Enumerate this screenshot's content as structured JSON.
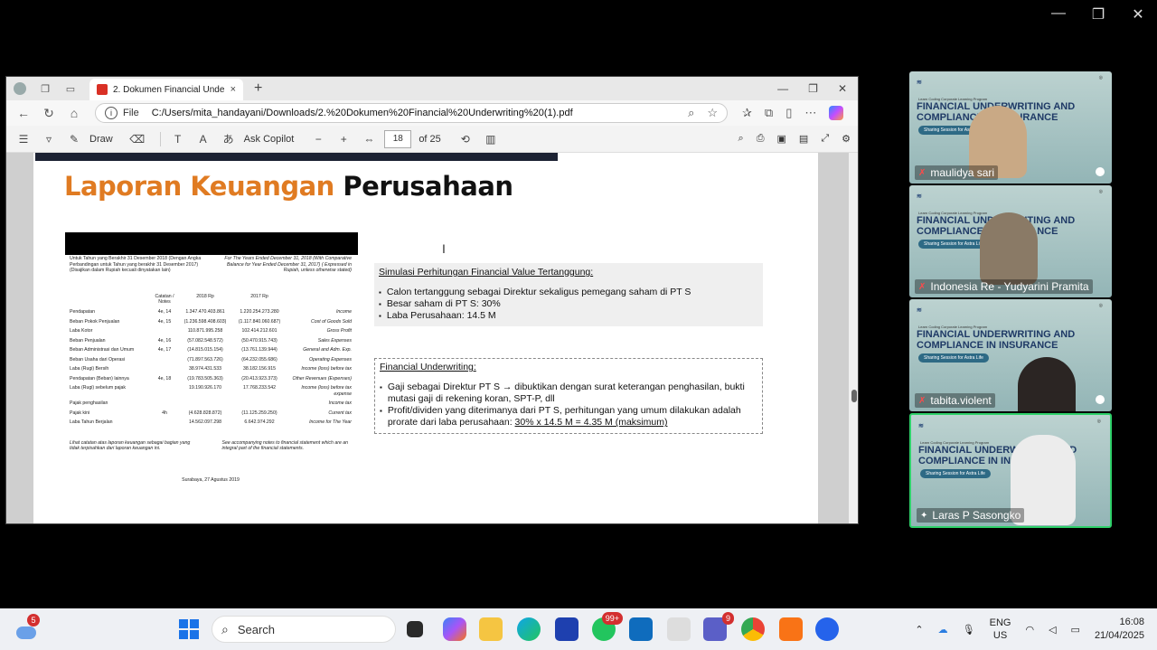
{
  "zoom_window": {
    "minimize": "—",
    "restore": "❐",
    "close": "✕"
  },
  "browser": {
    "tab_title": "2. Dokumen Financial Underwriting",
    "new_tab": "+",
    "tab_close": "×",
    "win_minimize": "—",
    "win_restore": "❐",
    "win_close": "✕",
    "url_scheme": "File",
    "url": "C:/Users/mita_handayani/Downloads/2.%20Dokumen%20Financial%20Underwriting%20(1).pdf"
  },
  "pdf_toolbar": {
    "draw_label": "Draw",
    "ask_copilot_label": "Ask Copilot",
    "zoom_out": "−",
    "zoom_in": "+",
    "page_current": "18",
    "page_total": "of 25"
  },
  "slide": {
    "title_part1": "Laporan Keuangan",
    "title_part2": "Perusahaan",
    "fin_header_left": "Untuk Tahun yang Berakhir 31 Desember 2018 (Dengan Angka Perbandingan untuk Tahun yang berakhir 31 Desember 2017) (Disajikan dalam Rupiah kecuali dinyatakan lain)",
    "fin_header_right": "For The Years Ended December 31, 2018 (With Comparative Balance for Year Ended December 31, 2017) ( Expressed in Rupiah, unless otherwise stated)",
    "col_note": "Catatan / Notes",
    "col_2018": "2018 Rp",
    "col_2017": "2017 Rp",
    "rows": [
      {
        "label": "Pendapatan",
        "note": "4e, 14",
        "v2018": "1.347.470.403.861",
        "v2017": "1.220.254.273.280",
        "en": "Income"
      },
      {
        "label": "Beban Pokok Penjualan",
        "note": "4e, 15",
        "v2018": "(1.236.598.408.603)",
        "v2017": "(1.117.840.060.687)",
        "en": "Cost of Goods Sold"
      },
      {
        "label": "Laba Kotor",
        "note": "",
        "v2018": "110.871.995.258",
        "v2017": "102.414.212.601",
        "en": "Gross Profit"
      },
      {
        "label": "Beban Penjualan",
        "note": "4e, 16",
        "v2018": "(57.082.548.572)",
        "v2017": "(50.470.915.743)",
        "en": "Sales Expenses"
      },
      {
        "label": "Beban Administrasi dan Umum",
        "note": "4e, 17",
        "v2018": "(14.815.015.154)",
        "v2017": "(13.761.139.944)",
        "en": "General and Adm. Exp."
      },
      {
        "label": "Beban Usaha dari Operasi",
        "note": "",
        "v2018": "(71.897.563.726)",
        "v2017": "(64.232.055.686)",
        "en": "Operating Expenses"
      },
      {
        "label": "Laba (Rugi) Bersih",
        "note": "",
        "v2018": "38.974.431.533",
        "v2017": "38.182.156.915",
        "en": "Income (loss) before tax"
      },
      {
        "label": "Pendapatan (Beban) lainnya",
        "note": "4e, 18",
        "v2018": "(19.783.505.363)",
        "v2017": "(20.413.923.373)",
        "en": "Other Revenues (Expenses)"
      },
      {
        "label": "Laba (Rugi) sebelum pajak",
        "note": "",
        "v2018": "19.190.926.170",
        "v2017": "17.768.233.542",
        "en": "Income (loss) before tax expense"
      },
      {
        "label": "Pajak penghasilan",
        "note": "",
        "v2018": "",
        "v2017": "",
        "en": "Income tax"
      },
      {
        "label": "Pajak kini",
        "note": "4h",
        "v2018": "(4.628.828.872)",
        "v2017": "(11.125.259.250)",
        "en": "Current tax"
      },
      {
        "label": "Laba Tahun Berjalan",
        "note": "",
        "v2018": "14.562.097.298",
        "v2017": "6.642.974.292",
        "en": "Income for The Year"
      }
    ],
    "fin_foot_left": "Lihat catatan atas laporan keuangan sebagai bagian yang tidak terpisahkan dari laporan keuangan ini.",
    "fin_foot_right": "See accompanying notes to financial statement which are an integral part of the financial statements.",
    "fin_date": "Surabaya, 27 Agustus 2019",
    "box1": {
      "title": "Simulasi Perhitungan Financial Value Tertanggung:",
      "items": [
        "Calon tertanggung sebagai Direktur sekaligus pemegang saham di PT S",
        "Besar saham di PT S: 30%",
        "Laba Perusahaan: 14.5 M"
      ]
    },
    "box2": {
      "title": "Financial Underwriting:",
      "item1": "Gaji sebagai Direktur PT S → dibuktikan dengan surat keterangan penghasilan, bukti mutasi gaji di rekening koran, SPT-P, dll",
      "item2_pre": "Profit/dividen yang diterimanya dari PT S, perhitungan yang umum dilakukan adalah prorate dari laba perusahaan: ",
      "item2_formula": "30% x 14.5 M = 4.35 M (maksimum)"
    }
  },
  "participants": [
    {
      "name": "maulidya sari"
    },
    {
      "name": "Indonesia Re - Yudyarini Pramita"
    },
    {
      "name": "tabita.violent"
    },
    {
      "name": "Laras P Sasongko"
    }
  ],
  "tile_banner": {
    "program": "Learn Coding Corporate Learning Program",
    "headline": "FINANCIAL UNDERWRITING AND COMPLIANCE IN INSURANCE",
    "pill": "Sharing Session for Astra Life"
  },
  "taskbar": {
    "weather_badge": "5",
    "search_placeholder": "Search",
    "whatsapp_badge": "99+",
    "teams_badge": "9",
    "lang_top": "ENG",
    "lang_bottom": "US",
    "time": "16:08",
    "date": "21/04/2025"
  }
}
